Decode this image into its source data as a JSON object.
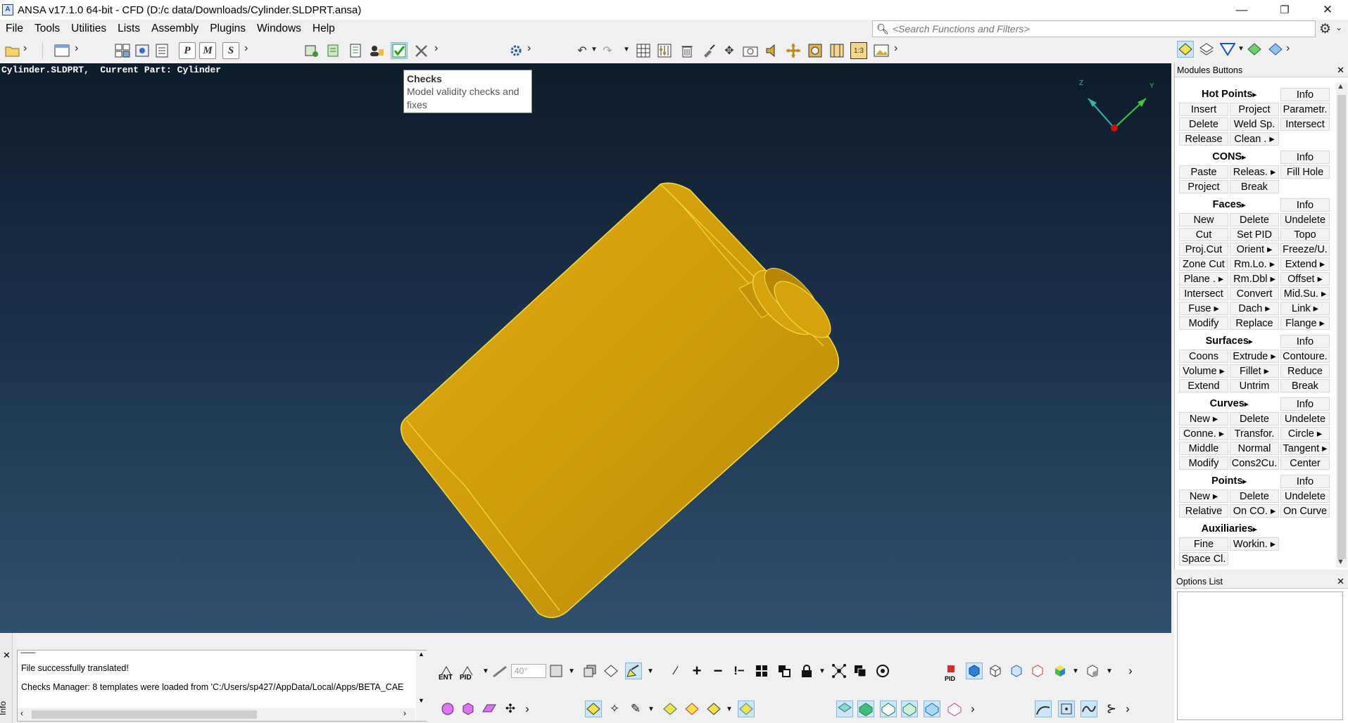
{
  "window": {
    "title": "ANSA v17.1.0 64-bit - CFD (D:/c data/Downloads/Cylinder.SLDPRT.ansa)",
    "minimize": "—",
    "restore": "❐",
    "close": "✕"
  },
  "menu": [
    "File",
    "Tools",
    "Utilities",
    "Lists",
    "Assembly",
    "Plugins",
    "Windows",
    "Help"
  ],
  "search": {
    "placeholder": "<Search Functions and Filters>"
  },
  "viewport": {
    "part_header": "Cylinder.SLDPRT,  Current Part: Cylinder",
    "axis_z": "Z",
    "axis_y": "Y",
    "model_color": "#d8a60a",
    "background_top": "#0e1c2b",
    "background_bottom": "#2f5170"
  },
  "tooltip": {
    "title": "Checks",
    "body": "Model validity checks and fixes"
  },
  "toolbar": {
    "box_buttons": [
      "P",
      "M",
      "S"
    ],
    "ratio_label": "1:3"
  },
  "modules": {
    "panel_title": "Modules Buttons",
    "sections": [
      {
        "title": "Hot Points",
        "info": "Info",
        "rows": [
          [
            "Insert",
            "Project",
            "Parametr."
          ],
          [
            "Delete",
            "Weld Sp.",
            "Intersect"
          ],
          [
            "Release",
            "Clean . ▸",
            ""
          ]
        ]
      },
      {
        "title": "CONS",
        "info": "Info",
        "rows": [
          [
            "Paste",
            "Releas. ▸",
            "Fill Hole"
          ],
          [
            "Project",
            "Break",
            ""
          ]
        ]
      },
      {
        "title": "Faces",
        "info": "Info",
        "rows": [
          [
            "New",
            "Delete",
            "Undelete"
          ],
          [
            "Cut",
            "Set PID",
            "Topo"
          ],
          [
            "Proj.Cut",
            "Orient ▸",
            "Freeze/U."
          ],
          [
            "Zone Cut",
            "Rm.Lo. ▸",
            "Extend ▸"
          ],
          [
            "Plane . ▸",
            "Rm.Dbl ▸",
            "Offset ▸"
          ],
          [
            "Intersect",
            "Convert",
            "Mid.Su. ▸"
          ],
          [
            "Fuse ▸",
            "Dach ▸",
            "Link ▸"
          ],
          [
            "Modify",
            "Replace",
            "Flange ▸"
          ]
        ]
      },
      {
        "title": "Surfaces",
        "info": "Info",
        "rows": [
          [
            "Coons",
            "Extrude ▸",
            "Contoure."
          ],
          [
            "Volume ▸",
            "Fillet ▸",
            "Reduce"
          ],
          [
            "Extend",
            "Untrim",
            "Break"
          ]
        ]
      },
      {
        "title": "Curves",
        "info": "Info",
        "rows": [
          [
            "New ▸",
            "Delete",
            "Undelete"
          ],
          [
            "Conne. ▸",
            "Transfor.",
            "Circle ▸"
          ],
          [
            "Middle",
            "Normal",
            "Tangent ▸"
          ],
          [
            "Modify",
            "Cons2Cu.",
            "Center"
          ]
        ]
      },
      {
        "title": "Points",
        "info": "Info",
        "rows": [
          [
            "New ▸",
            "Delete",
            "Undelete"
          ],
          [
            "Relative",
            "On CO. ▸",
            "On Curve"
          ]
        ]
      },
      {
        "title": "Auxiliaries",
        "info": "",
        "rows": [
          [
            "Fine",
            "Workin. ▸",
            ""
          ],
          [
            "Space Cl.",
            "",
            ""
          ]
        ]
      }
    ]
  },
  "options": {
    "panel_title": "Options List"
  },
  "info_panel": {
    "label": "Info",
    "separator": "---------",
    "lines": [
      "File successfully translated!",
      "Checks Manager: 8 templates were loaded from 'C:/Users/sp427/AppData/Local/Apps/BETA_CAE"
    ]
  },
  "bottom_toolbar": {
    "ent": "ENT",
    "pid": "PID",
    "angle": "40°",
    "pid_small": "PID"
  }
}
